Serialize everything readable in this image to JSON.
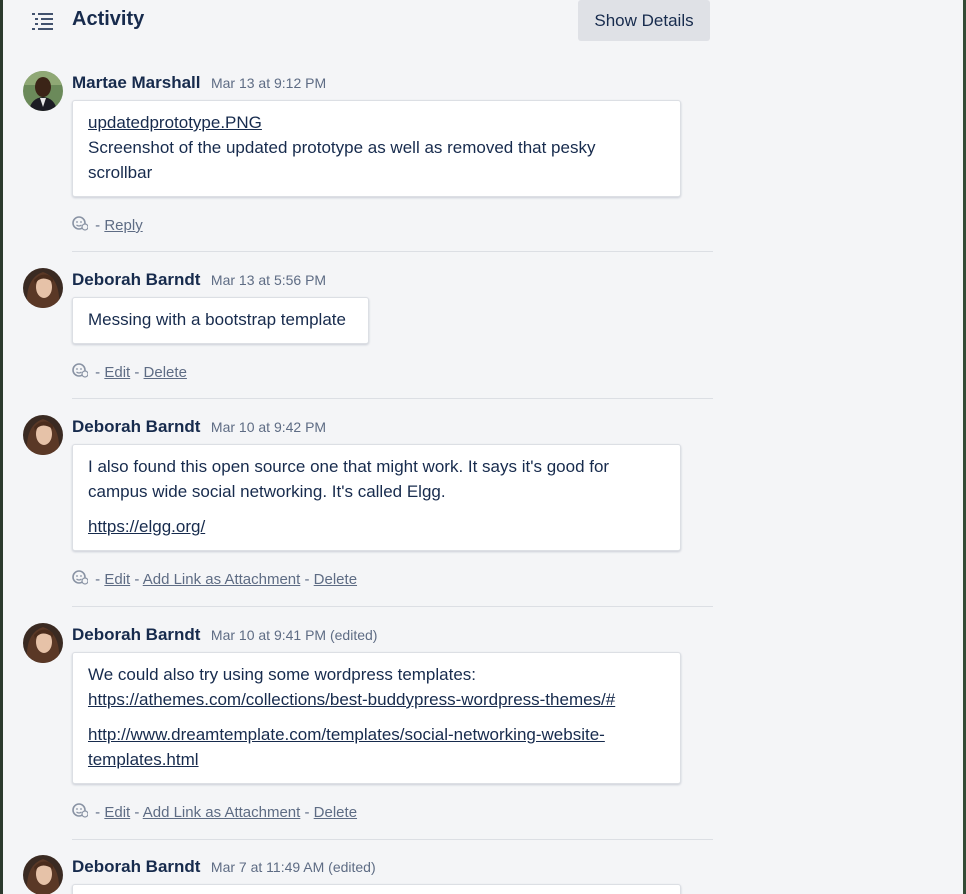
{
  "header": {
    "title": "Activity",
    "show_details_label": "Show Details"
  },
  "entries": [
    {
      "author": "Martae Marshall",
      "date": "Mar 13 at 9:12 PM",
      "lines": [
        "updatedprototype.PNG",
        "Screenshot of the updated prototype as well as removed that pesky",
        "scrollbar"
      ],
      "actions": [
        "Reply"
      ]
    },
    {
      "author": "Deborah Barndt",
      "date": "Mar 13 at 5:56 PM",
      "lines": [
        "Messing with a bootstrap template"
      ],
      "actions": [
        "Edit",
        "Delete"
      ]
    },
    {
      "author": "Deborah Barndt",
      "date": "Mar 10 at 9:42 PM",
      "lines": [
        "I also found this open source one that might work. It says it's good for",
        "campus wide social networking. It's called Elgg.",
        "https://elgg.org/"
      ],
      "actions": [
        "Edit",
        "Add Link as Attachment",
        "Delete"
      ]
    },
    {
      "author": "Deborah Barndt",
      "date": "Mar 10 at 9:41 PM (edited)",
      "lines": [
        "We could also try using some wordpress templates:",
        "https://athemes.com/collections/best-buddypress-wordpress-themes/#",
        "http://www.dreamtemplate.com/templates/social-networking-website-",
        "templates.html"
      ],
      "actions": [
        "Edit",
        "Add Link as Attachment",
        "Delete"
      ]
    },
    {
      "author": "Deborah Barndt",
      "date": "Mar 7 at 11:49 AM (edited)"
    }
  ],
  "separator": "-",
  "colors": {
    "panel_bg": "#f4f5f7",
    "text": "#172b4d",
    "muted": "#5e6c84",
    "button_bg": "#dfe1e6"
  },
  "icons": [
    "activity-list-icon",
    "add-reaction-icon"
  ]
}
